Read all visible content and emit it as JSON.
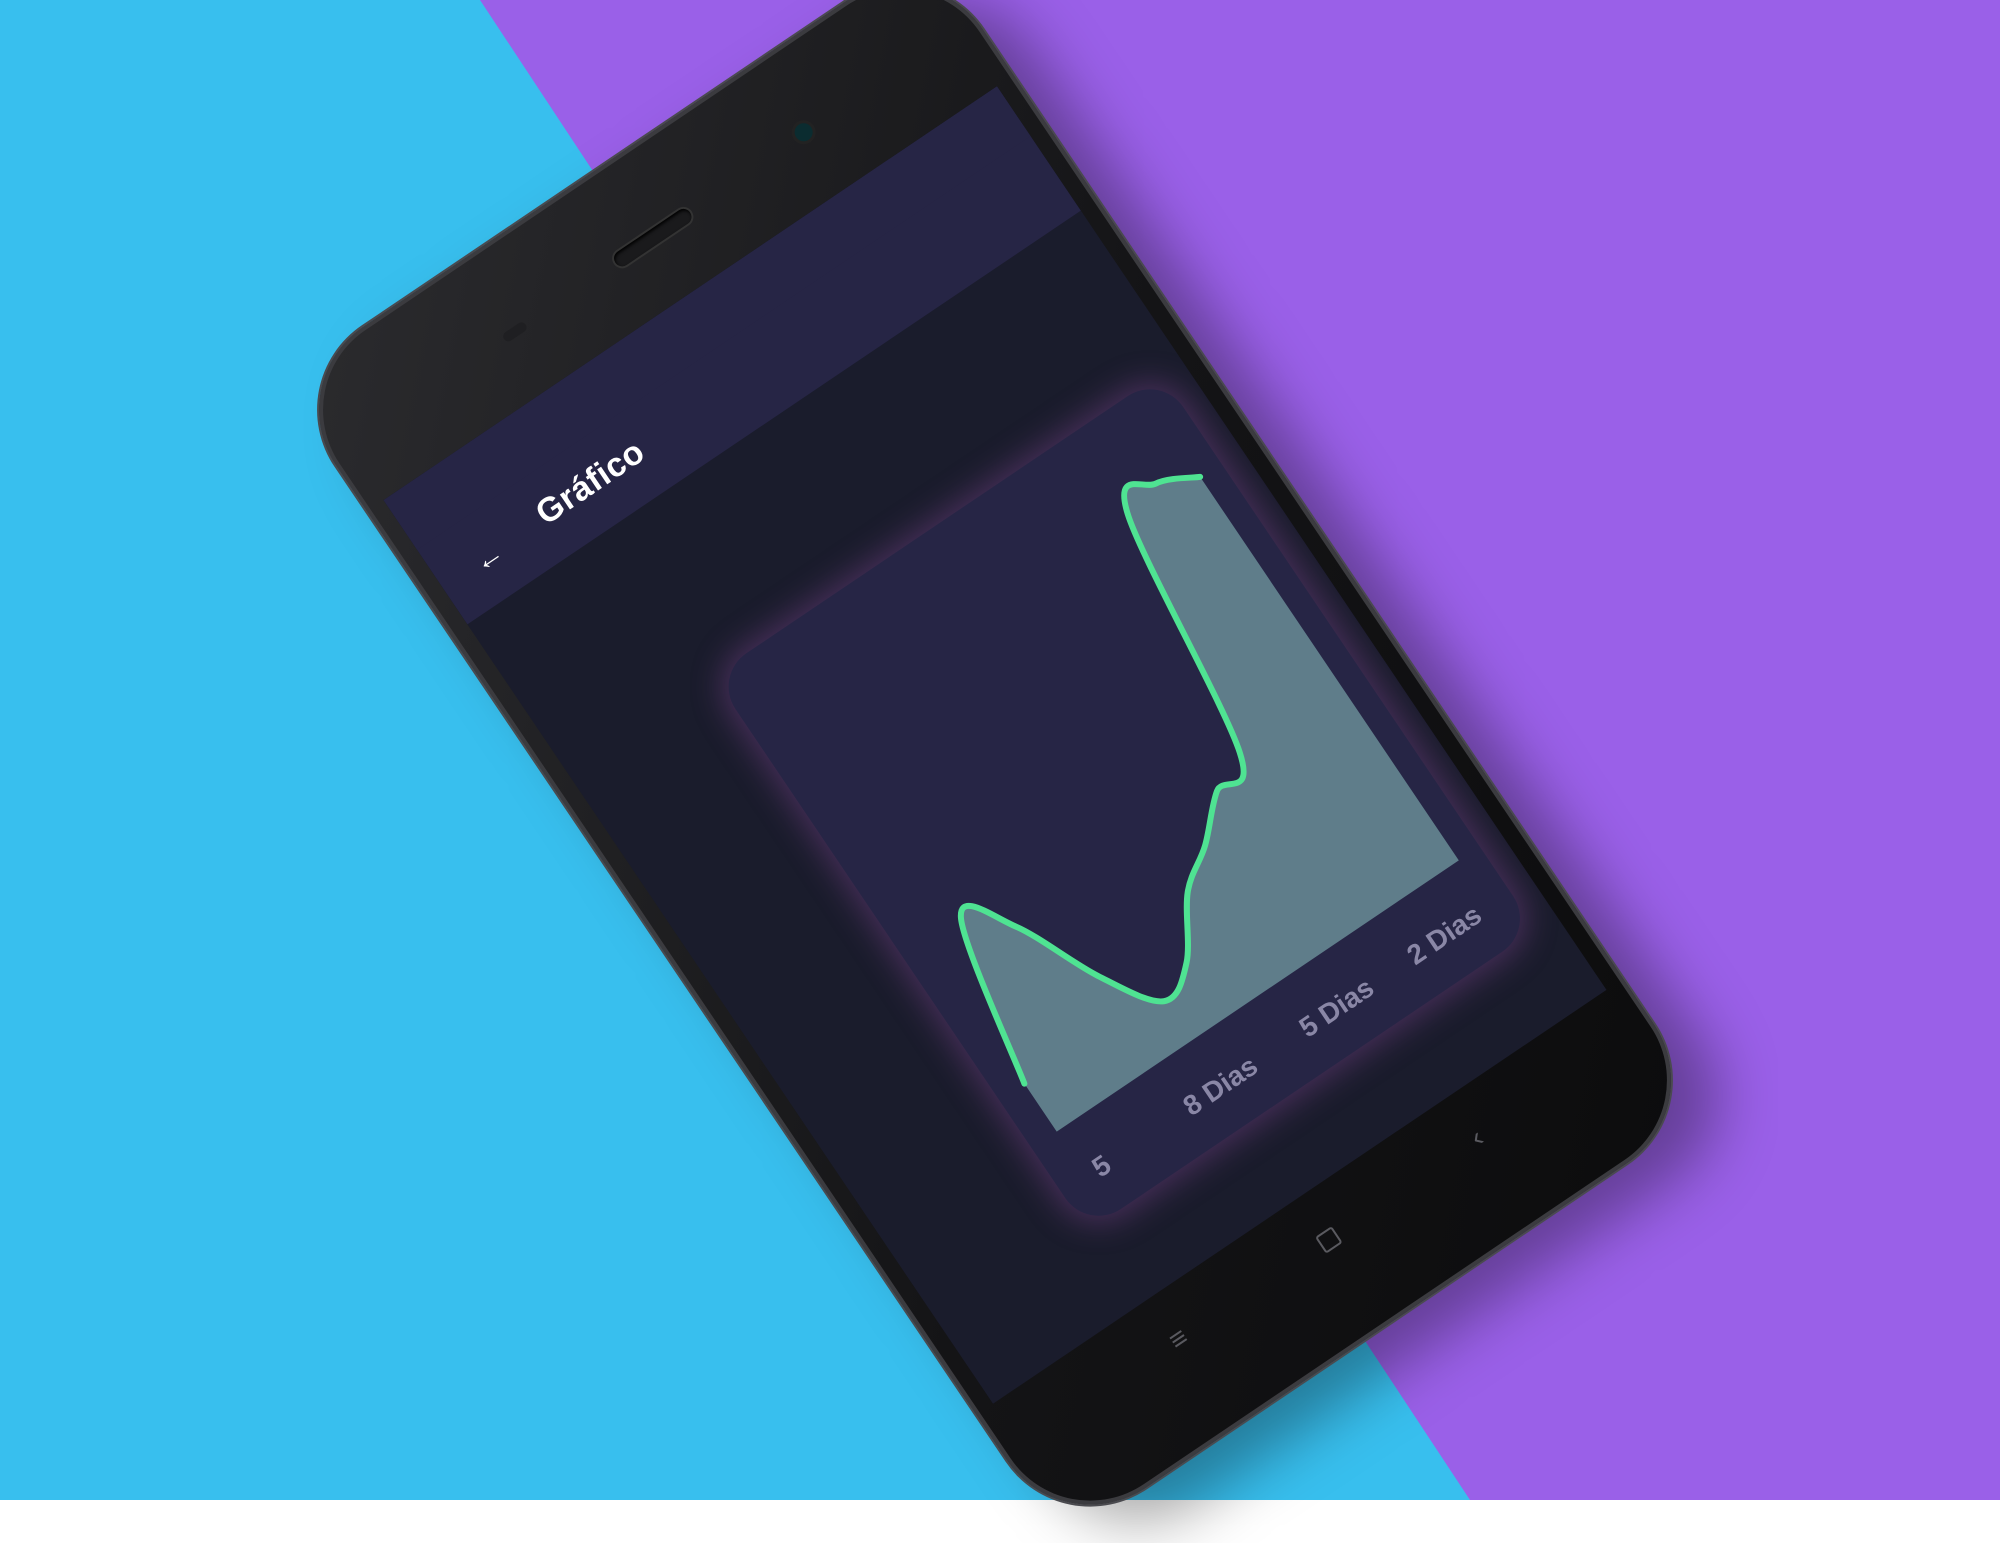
{
  "colors": {
    "background_left": "#38bfee",
    "background_right": "#9a60e8",
    "screen_bg": "#1a1c2c",
    "app_bar_bg": "#262545",
    "card_bg": "#262545",
    "area_fill": "#5f7d8a",
    "line": "#4fe392",
    "tick_text": "#8a87a6"
  },
  "app_bar": {
    "title": "Gráfico",
    "back_icon": "arrow-left-icon"
  },
  "nav": {
    "menu_icon": "menu-icon",
    "home_icon": "home-square-icon",
    "back_icon": "chevron-left-icon"
  },
  "chart_data": {
    "type": "area",
    "x_tick_labels": [
      "5",
      "8 Dias",
      "5 Dias",
      "2 Dias"
    ],
    "grid": false,
    "legend": "none",
    "series": [
      {
        "values": [
          12,
          48,
          40,
          22,
          10,
          14,
          26,
          32,
          40,
          44,
          98,
          100,
          96
        ]
      }
    ],
    "ylim": [
      0,
      110
    ]
  }
}
